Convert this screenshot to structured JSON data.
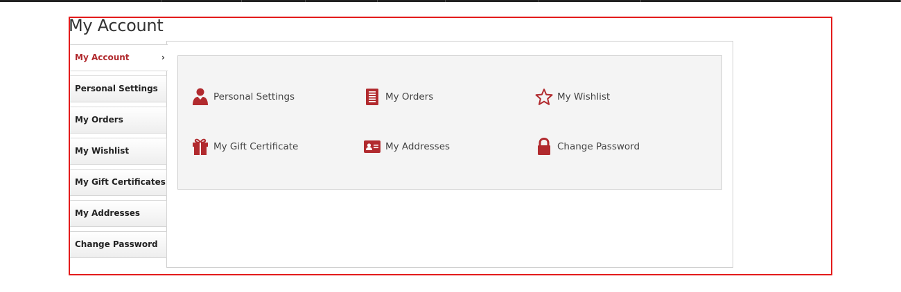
{
  "page": {
    "title": "My Account"
  },
  "sidebar": {
    "items": [
      {
        "label": "My Account",
        "active": true,
        "chevron": "›"
      },
      {
        "label": "Personal Settings"
      },
      {
        "label": "My Orders"
      },
      {
        "label": "My Wishlist"
      },
      {
        "label": "My Gift Certificates"
      },
      {
        "label": "My Addresses"
      },
      {
        "label": "Change Password"
      }
    ]
  },
  "dashboard": {
    "tiles": [
      {
        "label": "Personal Settings",
        "icon": "user-icon"
      },
      {
        "label": "My Orders",
        "icon": "orders-document-icon"
      },
      {
        "label": "My Wishlist",
        "icon": "star-outline-icon"
      },
      {
        "label": "My Gift Certificate",
        "icon": "gift-icon"
      },
      {
        "label": "My Addresses",
        "icon": "address-card-icon"
      },
      {
        "label": "Change Password",
        "icon": "lock-icon"
      }
    ]
  },
  "colors": {
    "accent": "#b12a2e",
    "frame": "#e31b1b",
    "text": "#444444"
  }
}
